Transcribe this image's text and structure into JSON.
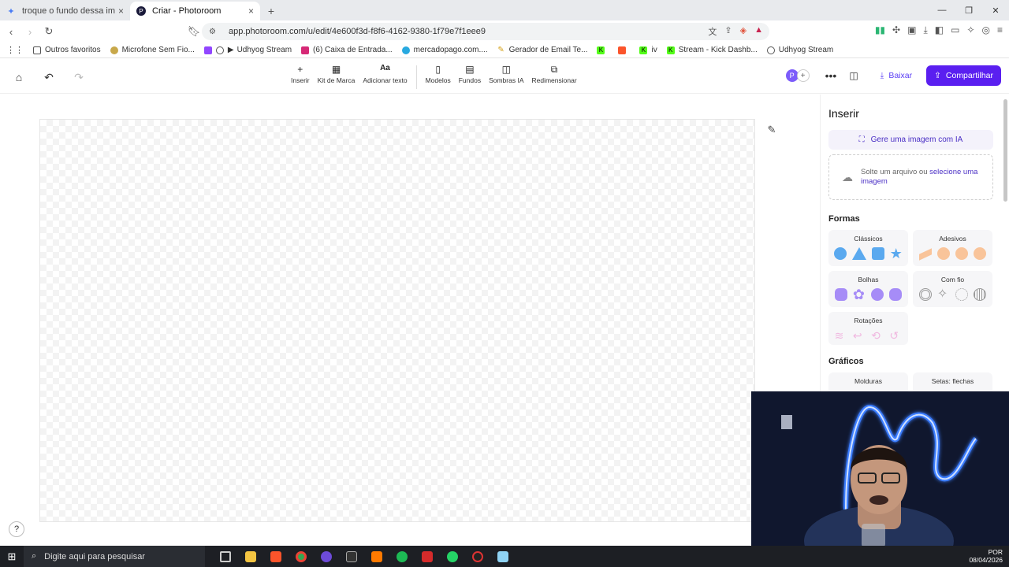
{
  "browser": {
    "tabs": [
      {
        "title": "troque o fundo dessa imagem roxo",
        "active": false
      },
      {
        "title": "Criar - Photoroom",
        "active": true
      }
    ],
    "url": "app.photoroom.com/u/edit/4e600f3d-f8f6-4162-9380-1f79e7f1eee9",
    "bookmarks": [
      "Outros favoritos",
      "Microfone Sem Fio...",
      "Udhyog Stream",
      "(6) Caixa de Entrada...",
      "mercadopago.com....",
      "Gerador de Email Te...",
      "iv",
      "Stream - Kick Dashb...",
      "Udhyog Stream"
    ]
  },
  "toolbar": {
    "tools": [
      {
        "label": "Inserir",
        "icon": "plus-icon"
      },
      {
        "label": "Kit de Marca",
        "icon": "brand-kit-icon"
      },
      {
        "label": "Adicionar texto",
        "icon": "text-icon",
        "glyph": "Aa"
      },
      {
        "label": "Modelos",
        "icon": "templates-icon"
      },
      {
        "label": "Fundos",
        "icon": "backgrounds-icon"
      },
      {
        "label": "Sombras IA",
        "icon": "shadow-icon"
      },
      {
        "label": "Redimensionar",
        "icon": "resize-icon"
      }
    ],
    "avatar_letter": "P",
    "download_label": "Baixar",
    "share_label": "Compartilhar"
  },
  "panel": {
    "title": "Inserir",
    "generate_label": "Gere uma imagem com IA",
    "drop_text": "Solte um arquivo ou ",
    "drop_link": "selecione uma imagem",
    "shapes_title": "Formas",
    "cards": [
      {
        "label": "Clássicos"
      },
      {
        "label": "Adesivos"
      },
      {
        "label": "Bolhas"
      },
      {
        "label": "Com fio"
      },
      {
        "label": "Rotações"
      }
    ],
    "graphics_title": "Gráficos",
    "graphics_cards": [
      {
        "label": "Molduras"
      },
      {
        "label": "Setas: flechas"
      }
    ]
  },
  "taskbar": {
    "search_placeholder": "Digite aqui para pesquisar",
    "lang": "POR",
    "date": "08/04/2026"
  },
  "colors": {
    "accent": "#5a1ff0",
    "shape_blue": "#5aa9ef",
    "shape_purple": "#a68cf7",
    "shape_peach": "#f9c49a",
    "shape_pink": "#f0b8e0"
  }
}
